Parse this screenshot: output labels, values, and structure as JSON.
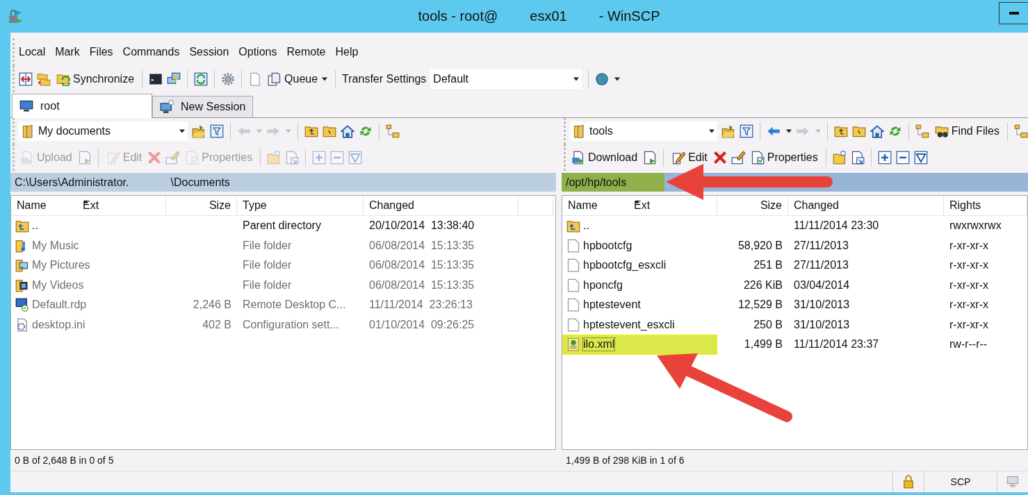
{
  "window": {
    "title_parts": [
      "tools - root@",
      "esx01",
      "- WinSCP"
    ]
  },
  "menu": [
    "Local",
    "Mark",
    "Files",
    "Commands",
    "Session",
    "Options",
    "Remote",
    "Help"
  ],
  "toolbar": {
    "synchronize": "Synchronize",
    "queue": "Queue",
    "transfer_label": "Transfer Settings",
    "transfer_value": "Default"
  },
  "tabs": [
    {
      "label": "root",
      "selected": true
    },
    {
      "label": "New Session",
      "selected": false
    }
  ],
  "panels": [
    {
      "active": false,
      "location": "My documents",
      "can_go_back": false,
      "actions_disabled": true,
      "transfer": "Upload",
      "edit": "Edit",
      "properties": "Properties",
      "path_parts": [
        "C:\\Users\\Administrator.",
        "\\Documents"
      ],
      "path_highlighted": false,
      "columns": [
        "Name",
        "Ext",
        "Size",
        "Type",
        "Changed"
      ],
      "rows": [
        {
          "kind": "parent",
          "name": "..",
          "type": "Parent directory",
          "changed": "20/10/2014  13:38:40",
          "dimmed": false,
          "selected": false
        },
        {
          "kind": "music",
          "name": "My Music",
          "type": "File folder",
          "changed": "06/08/2014  15:13:35",
          "dimmed": true,
          "selected": false
        },
        {
          "kind": "pictures",
          "name": "My Pictures",
          "type": "File folder",
          "changed": "06/08/2014  15:13:35",
          "dimmed": true,
          "selected": false
        },
        {
          "kind": "videos",
          "name": "My Videos",
          "type": "File folder",
          "changed": "06/08/2014  15:13:35",
          "dimmed": true,
          "selected": false
        },
        {
          "kind": "remote",
          "name": "Default.rdp",
          "size": "2,246 B",
          "type": "Remote Desktop C...",
          "changed": "11/11/2014  23:26:13",
          "dimmed": true,
          "selected": false
        },
        {
          "kind": "settings",
          "name": "desktop.ini",
          "size": "402 B",
          "type": "Configuration sett...",
          "changed": "01/10/2014  09:26:25",
          "dimmed": true,
          "selected": false
        }
      ],
      "status": "0 B of 2,648 B in 0 of 5"
    },
    {
      "active": true,
      "location": "tools",
      "can_go_back": true,
      "actions_disabled": false,
      "transfer": "Download",
      "edit": "Edit",
      "properties": "Properties",
      "find_files": "Find Files",
      "path_parts": [
        "/opt/hp/tools"
      ],
      "path_highlighted": true,
      "columns": [
        "Name",
        "Ext",
        "Size",
        "Changed",
        "Rights"
      ],
      "rows": [
        {
          "kind": "parent",
          "name": "..",
          "changed": "11/11/2014 23:30",
          "rights": "rwxrwxrwx",
          "dimmed": false,
          "selected": false
        },
        {
          "kind": "file",
          "name": "hpbootcfg",
          "size": "58,920 B",
          "changed": "27/11/2013",
          "rights": "r-xr-xr-x",
          "dimmed": false,
          "selected": false
        },
        {
          "kind": "file",
          "name": "hpbootcfg_esxcli",
          "size": "251 B",
          "changed": "27/11/2013",
          "rights": "r-xr-xr-x",
          "dimmed": false,
          "selected": false
        },
        {
          "kind": "file",
          "name": "hponcfg",
          "size": "226 KiB",
          "changed": "03/04/2014",
          "rights": "r-xr-xr-x",
          "dimmed": false,
          "selected": false
        },
        {
          "kind": "file",
          "name": "hptestevent",
          "size": "12,529 B",
          "changed": "31/10/2013",
          "rights": "r-xr-xr-x",
          "dimmed": false,
          "selected": false
        },
        {
          "kind": "file",
          "name": "hptestevent_esxcli",
          "size": "250 B",
          "changed": "31/10/2013",
          "rights": "r-xr-xr-x",
          "dimmed": false,
          "selected": false
        },
        {
          "kind": "xml",
          "name": "ilo.xml",
          "size": "1,499 B",
          "changed": "11/11/2014 23:37",
          "rights": "rw-r--r--",
          "dimmed": false,
          "selected": true
        }
      ],
      "status": "1,499 B of 298 KiB in 1 of 6"
    }
  ],
  "status_bar": {
    "protocol": "SCP"
  }
}
